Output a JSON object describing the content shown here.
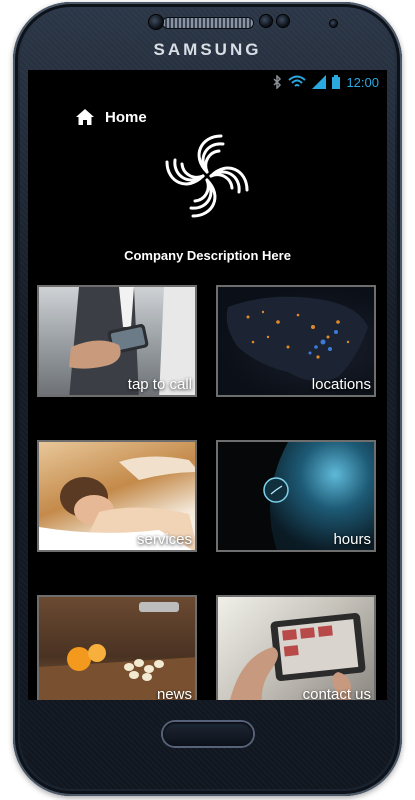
{
  "device": {
    "brand": "SAMSUNG"
  },
  "status_bar": {
    "time": "12:00",
    "accent_color": "#2aa8e0",
    "icons": [
      "bluetooth-icon",
      "wifi-icon",
      "signal-icon",
      "battery-icon"
    ]
  },
  "header": {
    "home_label": "Home",
    "home_icon": "house-icon"
  },
  "company": {
    "description": "Company Description Here"
  },
  "tiles": [
    {
      "label": "tap to call"
    },
    {
      "label": "locations"
    },
    {
      "label": "services"
    },
    {
      "label": "hours"
    },
    {
      "label": "news"
    },
    {
      "label": "contact us"
    }
  ]
}
